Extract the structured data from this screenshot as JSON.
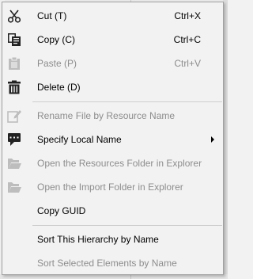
{
  "menu": {
    "items": [
      {
        "label": "Cut (T)",
        "shortcut": "Ctrl+X",
        "icon": "scissors-icon",
        "enabled": true
      },
      {
        "label": "Copy (C)",
        "shortcut": "Ctrl+C",
        "icon": "copy-icon",
        "enabled": true
      },
      {
        "label": "Paste (P)",
        "shortcut": "Ctrl+V",
        "icon": "paste-icon",
        "enabled": false
      },
      {
        "label": "Delete (D)",
        "shortcut": "",
        "icon": "trash-icon",
        "enabled": true
      },
      {
        "label": "Rename File by Resource Name",
        "shortcut": "",
        "icon": "pencil-edit-icon",
        "enabled": false
      },
      {
        "label": "Specify Local Name",
        "shortcut": "",
        "icon": "speech-bubble-icon",
        "enabled": true,
        "submenu": true
      },
      {
        "label": "Open the Resources Folder in Explorer",
        "shortcut": "",
        "icon": "folder-open-icon",
        "enabled": false
      },
      {
        "label": "Open the Import Folder in Explorer",
        "shortcut": "",
        "icon": "folder-open-icon",
        "enabled": false
      },
      {
        "label": "Copy GUID",
        "shortcut": "",
        "icon": "",
        "enabled": true
      },
      {
        "label": "Sort This Hierarchy by Name",
        "shortcut": "",
        "icon": "",
        "enabled": true
      },
      {
        "label": "Sort Selected Elements by Name",
        "shortcut": "",
        "icon": "",
        "enabled": false
      }
    ]
  }
}
